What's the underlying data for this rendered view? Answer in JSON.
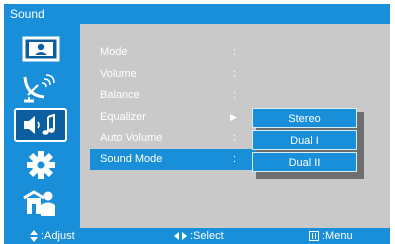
{
  "window": {
    "title": "Sound"
  },
  "sidebar": {
    "items": [
      {
        "icon": "picture-icon",
        "active": false
      },
      {
        "icon": "satellite-dish-icon",
        "active": false
      },
      {
        "icon": "sound-icon",
        "active": true
      },
      {
        "icon": "gear-icon",
        "active": false
      },
      {
        "icon": "parental-lock-icon",
        "active": false
      }
    ]
  },
  "menu": {
    "items": [
      {
        "label": "Mode",
        "indicator": ":"
      },
      {
        "label": "Volume",
        "indicator": ":"
      },
      {
        "label": "Balance",
        "indicator": ":"
      },
      {
        "label": "Equalizer",
        "indicator": "▶"
      },
      {
        "label": "Auto Volume",
        "indicator": ":"
      },
      {
        "label": "Sound Mode",
        "indicator": ":"
      }
    ],
    "selected": "Sound Mode"
  },
  "popup": {
    "options": [
      "Stereo",
      "Dual I",
      "Dual II"
    ]
  },
  "footer": {
    "adjust_icon": "up-down-arrows-icon",
    "adjust_label": ":Adjust",
    "select_icon": "left-right-arrows-icon",
    "select_label": ":Select",
    "menu_icon": "menu-key-icon",
    "menu_label": ":Menu"
  },
  "colors": {
    "accent": "#1a8fd9",
    "panel": "#c9c9c9",
    "active_tile": "#0c5f9e"
  }
}
